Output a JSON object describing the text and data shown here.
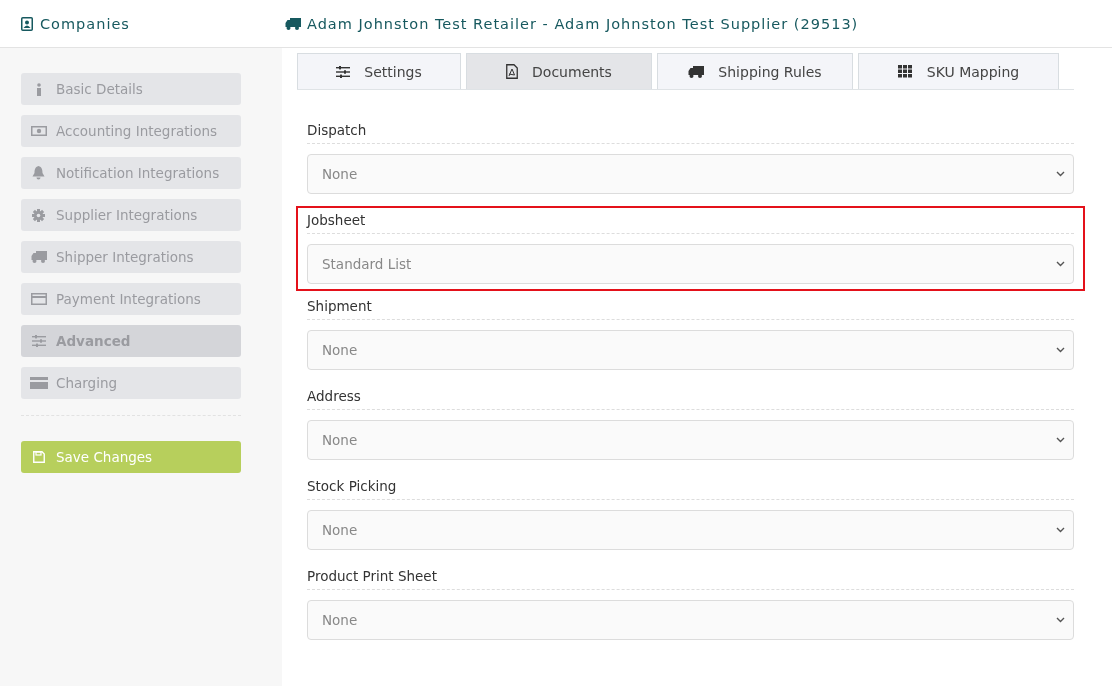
{
  "header": {
    "section": "Companies",
    "title": "Adam Johnston Test Retailer - Adam Johnston Test Supplier (29513)"
  },
  "sidebar": {
    "items": [
      {
        "label": "Basic Details",
        "kind": "info",
        "selected": false
      },
      {
        "label": "Accounting Integrations",
        "kind": "money",
        "selected": false
      },
      {
        "label": "Notification Integrations",
        "kind": "bell",
        "selected": false
      },
      {
        "label": "Supplier Integrations",
        "kind": "gear",
        "selected": false
      },
      {
        "label": "Shipper Integrations",
        "kind": "truck",
        "selected": false
      },
      {
        "label": "Payment Integrations",
        "kind": "card",
        "selected": false
      },
      {
        "label": "Advanced",
        "kind": "sliders",
        "selected": true
      },
      {
        "label": "Charging",
        "kind": "card2",
        "selected": false
      }
    ],
    "save_button": "Save Changes"
  },
  "tabs": [
    {
      "label": "Settings",
      "kind": "sliders",
      "selected": false
    },
    {
      "label": "Documents",
      "kind": "pdf",
      "selected": true
    },
    {
      "label": "Shipping Rules",
      "kind": "truck",
      "selected": false
    },
    {
      "label": "SKU Mapping",
      "kind": "grid",
      "selected": false
    }
  ],
  "fields": [
    {
      "label": "Dispatch",
      "value": "None",
      "highlighted": false
    },
    {
      "label": "Jobsheet",
      "value": "Standard List",
      "highlighted": true
    },
    {
      "label": "Shipment",
      "value": "None",
      "highlighted": false
    },
    {
      "label": "Address",
      "value": "None",
      "highlighted": false
    },
    {
      "label": "Stock Picking",
      "value": "None",
      "highlighted": false
    },
    {
      "label": "Product Print Sheet",
      "value": "None",
      "highlighted": false
    }
  ]
}
